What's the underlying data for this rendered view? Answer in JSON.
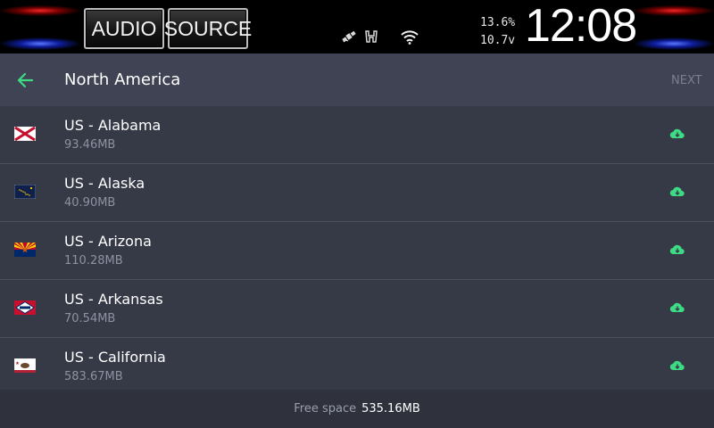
{
  "statusbar": {
    "audio_label": "AUDIO",
    "source_label": "SOURCE",
    "metric_top": "13.6%",
    "metric_bottom": "10.7v",
    "clock": "12:08",
    "icons": [
      "gps-icon",
      "honda-logo-icon",
      "wifi-icon"
    ]
  },
  "header": {
    "title": "North America",
    "next_label": "NEXT",
    "accent_color": "#3ddc84"
  },
  "regions": [
    {
      "name": "US - Alabama",
      "size": "93.46MB",
      "flag": "alabama-flag-icon"
    },
    {
      "name": "US - Alaska",
      "size": "40.90MB",
      "flag": "alaska-flag-icon"
    },
    {
      "name": "US - Arizona",
      "size": "110.28MB",
      "flag": "arizona-flag-icon"
    },
    {
      "name": "US - Arkansas",
      "size": "70.54MB",
      "flag": "arkansas-flag-icon"
    },
    {
      "name": "US - California",
      "size": "583.67MB",
      "flag": "california-flag-icon"
    }
  ],
  "footer": {
    "free_space_label": "Free space",
    "free_space_value": "535.16MB"
  }
}
